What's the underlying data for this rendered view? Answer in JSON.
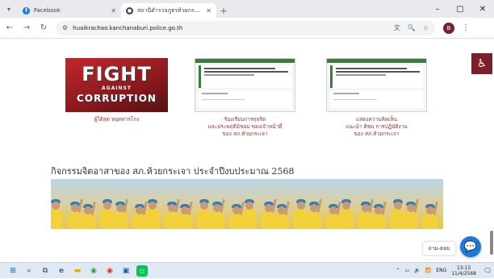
{
  "browser": {
    "tabs": [
      {
        "title": "Facebook",
        "active": false,
        "favicon_color": "#1877f2",
        "favicon_glyph": "f"
      },
      {
        "title": "สถานีตำรวจภูธรห้วยกระเจา – สถานีตำ...",
        "active": true,
        "favicon_color": "#444444",
        "favicon_glyph": "●"
      }
    ],
    "new_tab_icon": "plus-icon",
    "window_controls": [
      "minimize-icon",
      "maximize-icon",
      "close-icon"
    ],
    "url": "huaikrachao.kanchanaburi.police.go.th",
    "profile_initial": "B"
  },
  "page": {
    "cards": [
      {
        "caption_lines": [
          "ผู้ใต้สุด หยุดทารโกง"
        ]
      },
      {
        "caption_lines": [
          "ร้องเรียนการทุจริต",
          "และประพฤติมิชอบ ของเจ้าหน้าที่",
          "ของ สภ.ห้วยกระเจา"
        ]
      },
      {
        "caption_lines": [
          "แสดงความคิดเห็น",
          "แนะนำ ติชม การปฏิบัติงาน",
          "ของ สภ.ห้วยกระเจา"
        ]
      }
    ],
    "logo": {
      "line1": "FIGHT",
      "line2": "AGAINST",
      "line3": "CORRUPTION"
    },
    "heading": "กิจกรรมจิตอาสาของ สภ.ห้วยกระเจา ประจำปีงบประมาณ 2568",
    "chat_label": "ถาม-ตอบ"
  },
  "taskbar": {
    "time": "13:15",
    "date": "11/4/2568",
    "language": "ENG"
  },
  "colors": {
    "accent_maroon": "#7a1f2b",
    "chat_blue": "#1e7ad9",
    "caption_text": "#8b3a3a"
  }
}
